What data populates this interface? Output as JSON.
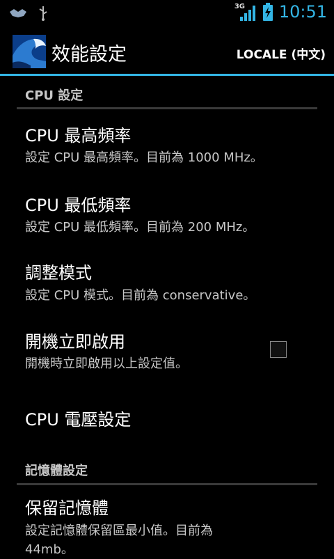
{
  "status_bar": {
    "network_type": "3G",
    "time": "10:51",
    "colors": {
      "clock": "#33b5e5"
    }
  },
  "action_bar": {
    "title": "效能設定",
    "locale_button": "LOCALE (中文)",
    "accent": "#33b5e5"
  },
  "sections": [
    {
      "header": "CPU 設定",
      "items": [
        {
          "title": "CPU 最高頻率",
          "summary": "設定 CPU 最高頻率。目前為 1000 MHz。"
        },
        {
          "title": "CPU 最低頻率",
          "summary": "設定 CPU 最低頻率。目前為 200 MHz。"
        },
        {
          "title": "調整模式",
          "summary": "設定 CPU 模式。目前為 conservative。"
        },
        {
          "title": "開機立即啟用",
          "summary": "開機時立即啟用以上設定值。",
          "checked": false
        },
        {
          "title": "CPU 電壓設定"
        }
      ]
    },
    {
      "header": "記憶體設定",
      "items": [
        {
          "title": "保留記憶體",
          "summary": "設定記憶體保留區最小值。目前為 44mb。"
        }
      ]
    }
  ]
}
